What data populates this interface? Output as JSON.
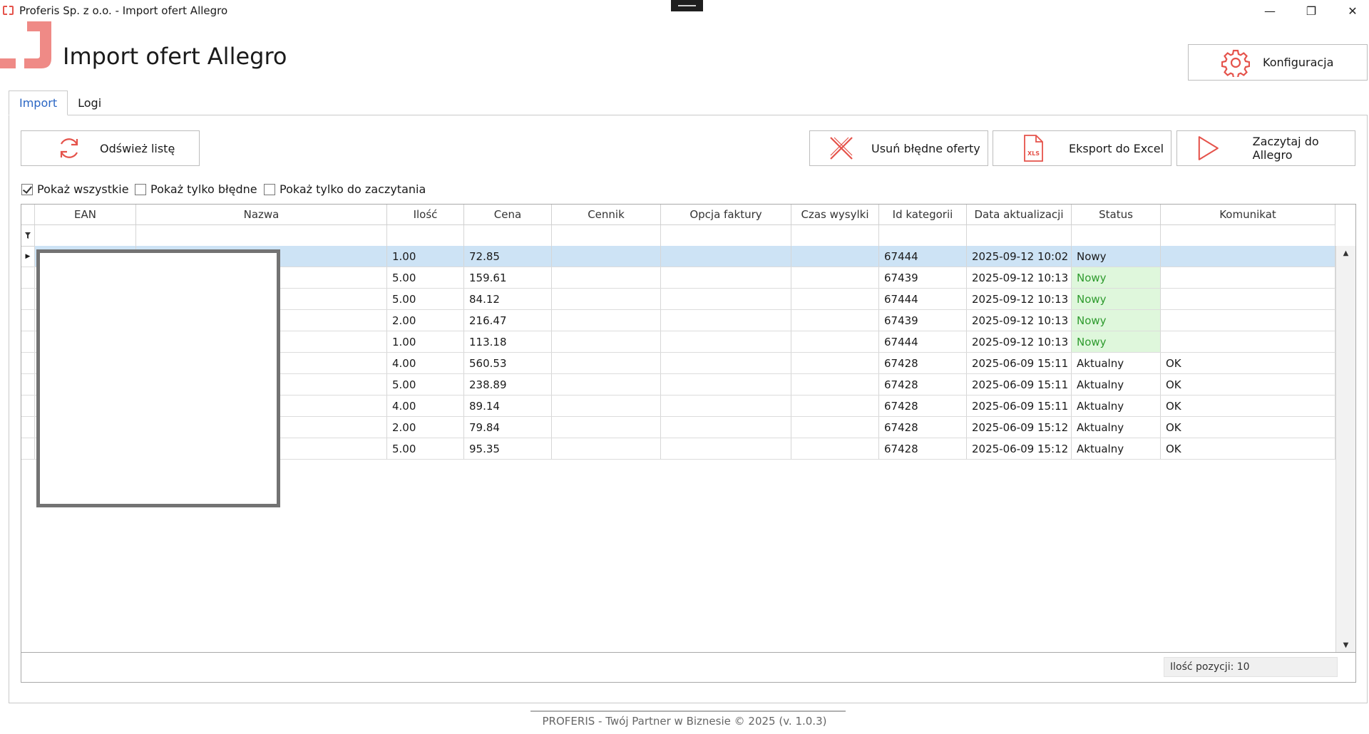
{
  "window": {
    "title": "Proferis Sp. z o.o. - Import ofert Allegro",
    "min_label": "—",
    "max_label": "❐",
    "close_label": "✕"
  },
  "header": {
    "title": "Import ofert Allegro",
    "config_label": "Konfiguracja",
    "accent": "#e5534b"
  },
  "tabs": [
    {
      "label": "Import",
      "active": true
    },
    {
      "label": "Logi",
      "active": false
    }
  ],
  "toolbar": {
    "refresh_label": "Odśwież listę",
    "delete_label": "Usuń błędne oferty",
    "excel_label": "Eksport do Excel",
    "excel_icon_text": "XLS",
    "allegro_label": "Zaczytaj do Allegro"
  },
  "filters": [
    {
      "label": "Pokaż wszystkie",
      "checked": true
    },
    {
      "label": "Pokaż tylko błędne",
      "checked": false
    },
    {
      "label": "Pokaż tylko do zaczytania",
      "checked": false
    }
  ],
  "grid": {
    "columns": [
      "EAN",
      "Nazwa",
      "Ilość",
      "Cena",
      "Cennik",
      "Opcja faktury",
      "Czas wysylki",
      "Id kategorii",
      "Data aktualizacji",
      "Status",
      "Komunikat"
    ],
    "rows": [
      {
        "ean": "",
        "nazwa": "",
        "ilosc": "1.00",
        "cena": "72.85",
        "cennik": "",
        "opcja": "",
        "czas": "",
        "kategoria": "67444",
        "data": "2025-09-12 10:02",
        "status": "Nowy",
        "komunikat": ""
      },
      {
        "ean": "",
        "nazwa": "",
        "ilosc": "5.00",
        "cena": "159.61",
        "cennik": "",
        "opcja": "",
        "czas": "",
        "kategoria": "67439",
        "data": "2025-09-12 10:13",
        "status": "Nowy",
        "komunikat": ""
      },
      {
        "ean": "",
        "nazwa": "",
        "ilosc": "5.00",
        "cena": "84.12",
        "cennik": "",
        "opcja": "",
        "czas": "",
        "kategoria": "67444",
        "data": "2025-09-12 10:13",
        "status": "Nowy",
        "komunikat": ""
      },
      {
        "ean": "",
        "nazwa": "",
        "ilosc": "2.00",
        "cena": "216.47",
        "cennik": "",
        "opcja": "",
        "czas": "",
        "kategoria": "67439",
        "data": "2025-09-12 10:13",
        "status": "Nowy",
        "komunikat": ""
      },
      {
        "ean": "",
        "nazwa": "",
        "ilosc": "1.00",
        "cena": "113.18",
        "cennik": "",
        "opcja": "",
        "czas": "",
        "kategoria": "67444",
        "data": "2025-09-12 10:13",
        "status": "Nowy",
        "komunikat": ""
      },
      {
        "ean": "",
        "nazwa": "",
        "ilosc": "4.00",
        "cena": "560.53",
        "cennik": "",
        "opcja": "",
        "czas": "",
        "kategoria": "67428",
        "data": "2025-06-09 15:11",
        "status": "Aktualny",
        "komunikat": "OK"
      },
      {
        "ean": "",
        "nazwa": "",
        "ilosc": "5.00",
        "cena": "238.89",
        "cennik": "",
        "opcja": "",
        "czas": "",
        "kategoria": "67428",
        "data": "2025-06-09 15:11",
        "status": "Aktualny",
        "komunikat": "OK"
      },
      {
        "ean": "",
        "nazwa": "",
        "ilosc": "4.00",
        "cena": "89.14",
        "cennik": "",
        "opcja": "",
        "czas": "",
        "kategoria": "67428",
        "data": "2025-06-09 15:11",
        "status": "Aktualny",
        "komunikat": "OK"
      },
      {
        "ean": "",
        "nazwa": "",
        "ilosc": "2.00",
        "cena": "79.84",
        "cennik": "",
        "opcja": "",
        "czas": "",
        "kategoria": "67428",
        "data": "2025-06-09 15:12",
        "status": "Aktualny",
        "komunikat": "OK"
      },
      {
        "ean": "",
        "nazwa": "",
        "ilosc": "5.00",
        "cena": "95.35",
        "cennik": "",
        "opcja": "",
        "czas": "",
        "kategoria": "67428",
        "data": "2025-06-09 15:12",
        "status": "Aktualny",
        "komunikat": "OK"
      }
    ],
    "count_label": "Ilość pozycji: 10",
    "selected_row": 0,
    "new_status_color": "#2e9b2e"
  },
  "footer": {
    "text": "PROFERIS - Twój Partner w Biznesie © 2025 (v. 1.0.3)"
  }
}
